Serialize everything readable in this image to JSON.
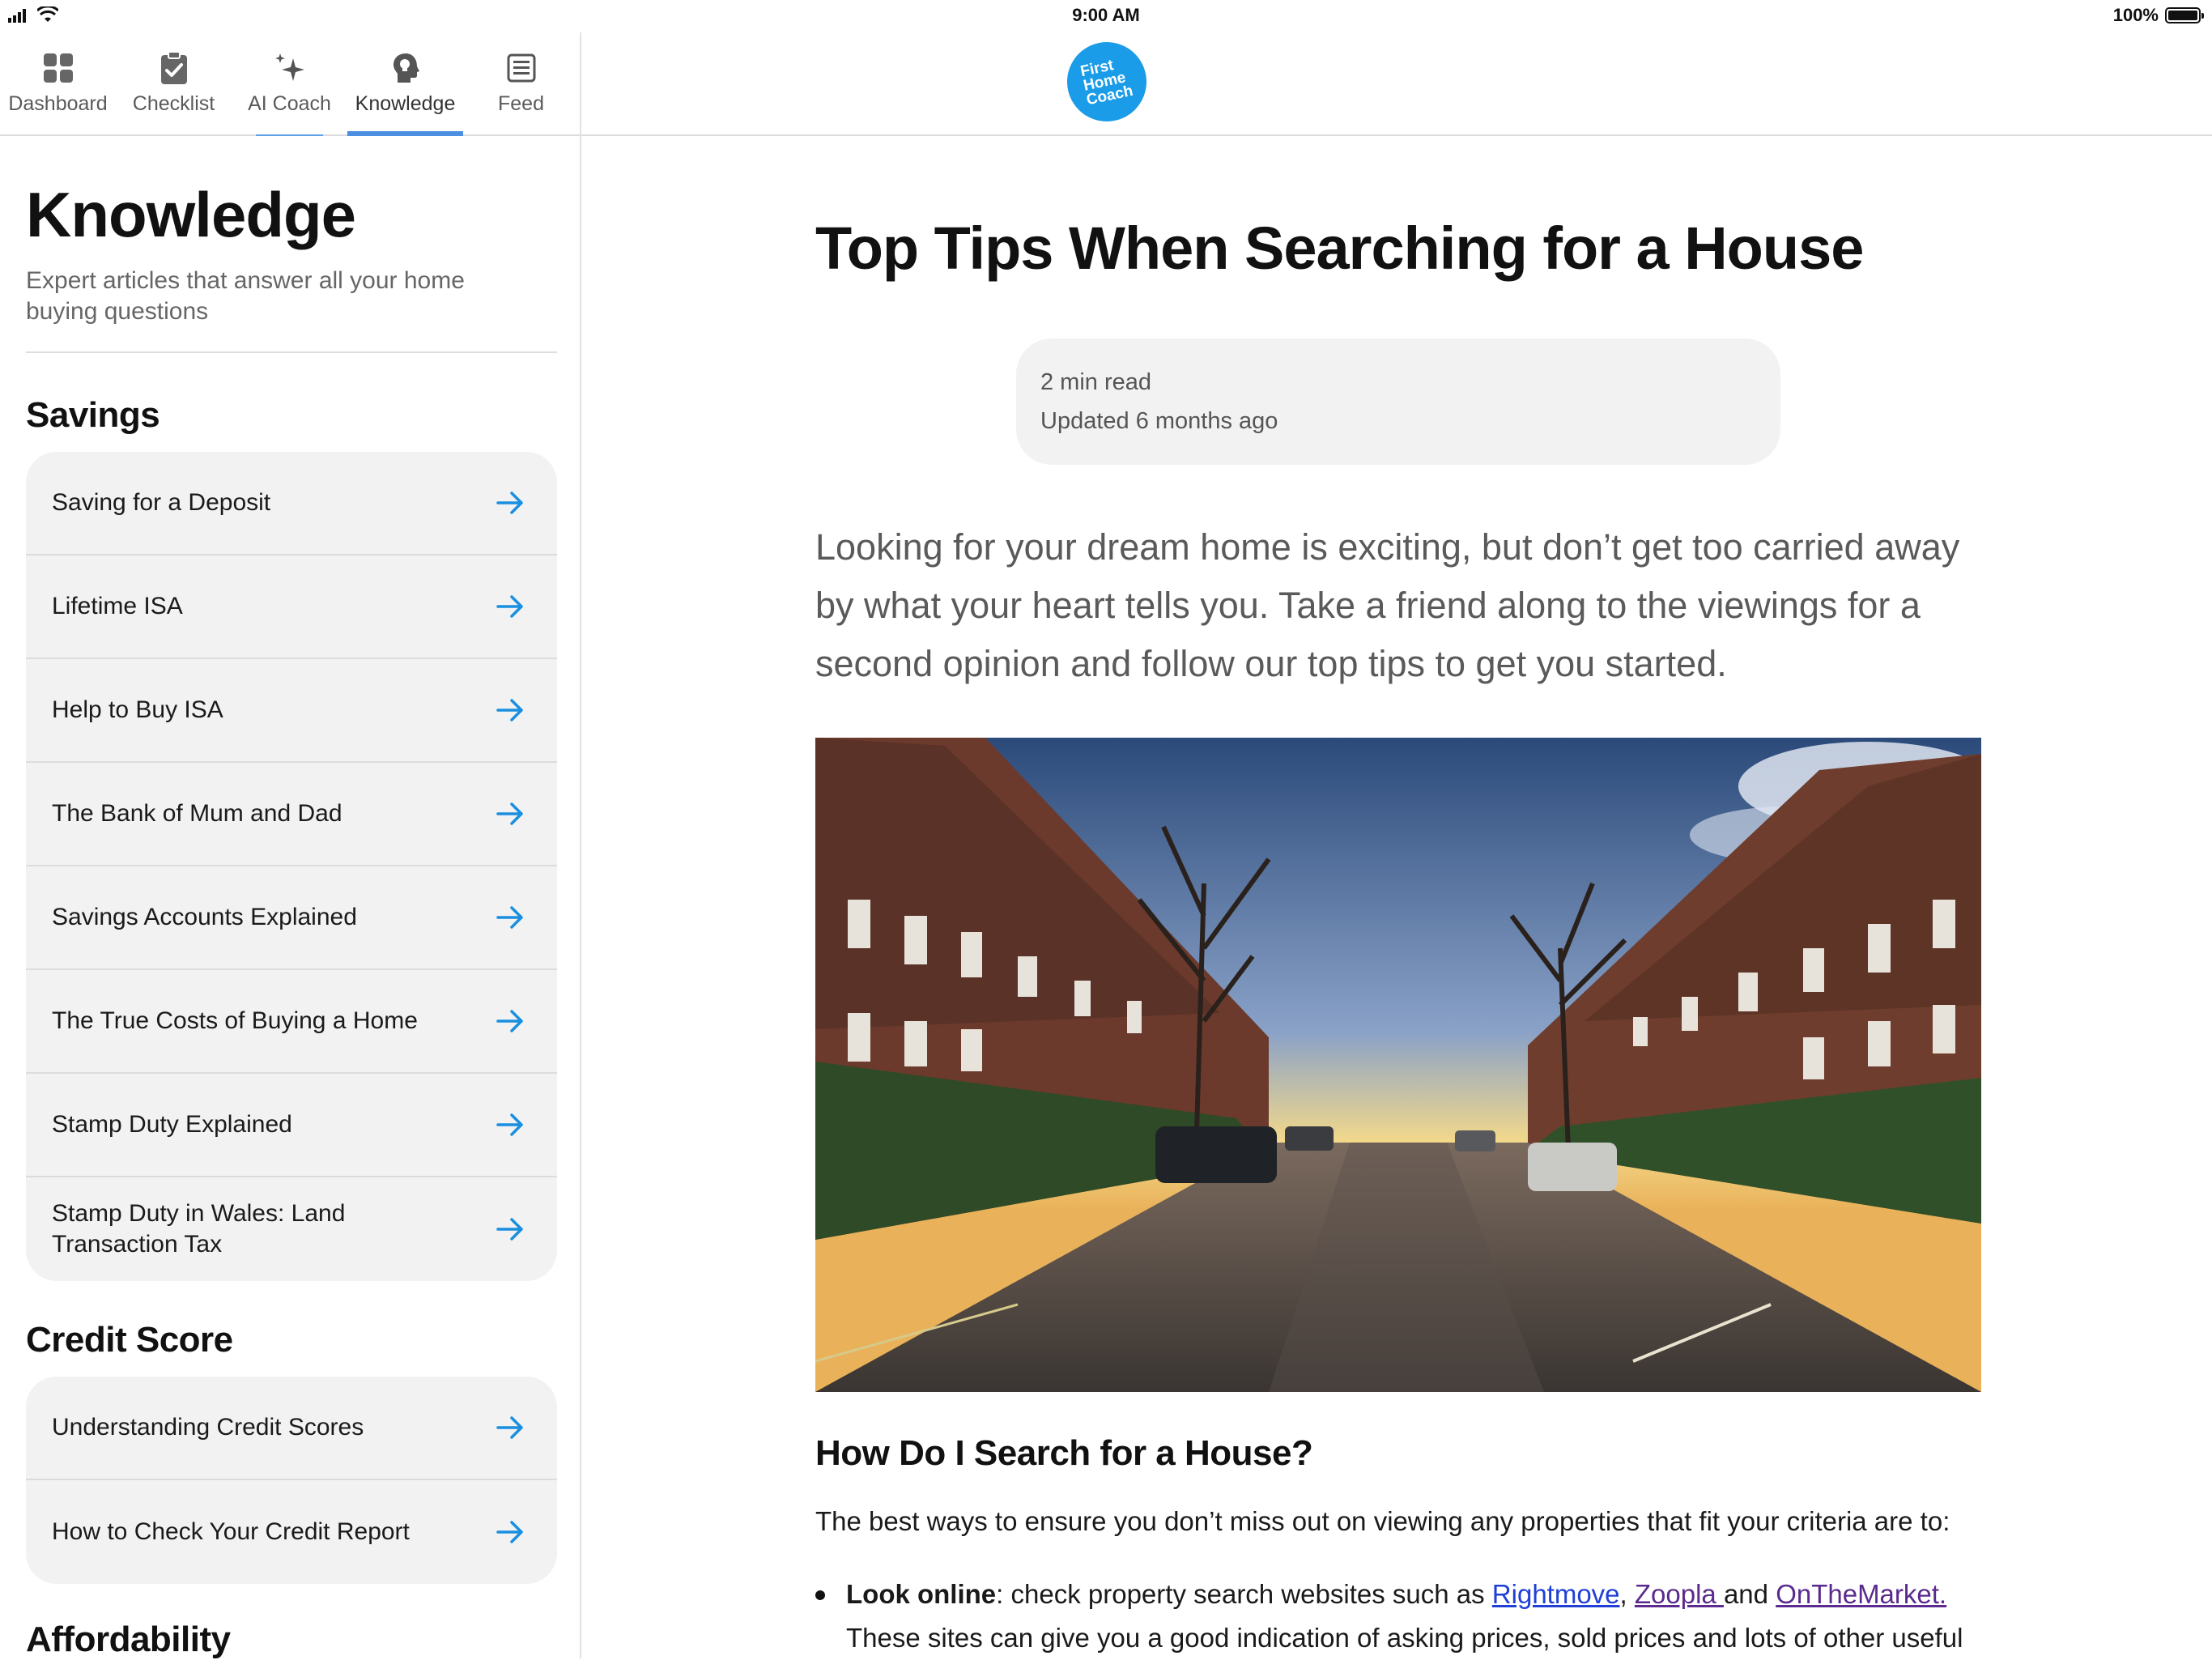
{
  "status_bar": {
    "time": "9:00 AM",
    "battery": "100%"
  },
  "tabs": [
    {
      "label": "Dashboard",
      "icon": "grid-icon"
    },
    {
      "label": "Checklist",
      "icon": "clipboard-check-icon"
    },
    {
      "label": "AI Coach",
      "icon": "sparkle-icon"
    },
    {
      "label": "Knowledge",
      "icon": "head-bulb-icon",
      "active": true
    },
    {
      "label": "Feed",
      "icon": "news-icon"
    }
  ],
  "knowledge": {
    "title": "Knowledge",
    "subtitle": "Expert articles that answer all your home buying questions"
  },
  "sections": [
    {
      "heading": "Savings",
      "items": [
        "Saving for a Deposit",
        "Lifetime ISA",
        "Help to Buy ISA",
        "The Bank of Mum and Dad",
        "Savings Accounts Explained",
        "The True Costs of Buying a Home",
        "Stamp Duty Explained",
        "Stamp Duty in Wales: Land Transaction Tax"
      ]
    },
    {
      "heading": "Credit Score",
      "items": [
        "Understanding Credit Scores",
        "How to Check Your Credit Report"
      ]
    },
    {
      "heading": "Affordability",
      "items": []
    }
  ],
  "logo": {
    "line1": "First",
    "line2": "Home",
    "line3": "Coach"
  },
  "article": {
    "title": "Top Tips When Searching for a House",
    "read_time": "2 min read",
    "updated": "Updated 6 months ago",
    "intro": "Looking for your dream home is exciting, but don’t get too carried away by what your heart tells you. Take a friend along to the viewings for a second opinion and follow our top tips to get you started.",
    "section_heading": "How Do I Search for a House?",
    "paragraph": "The best ways to ensure you don’t miss out on viewing any properties that fit your criteria are to:",
    "bullet": {
      "bold": "Look online",
      "text_before": ": check property search websites such as ",
      "link1": "Rightmove",
      "sep": ", ",
      "link2": "Zoopla ",
      "text_mid": "and ",
      "link3": "OnTheMarket.",
      "text_after": " These sites can give you a good indication of asking prices, sold prices and lots of other useful"
    }
  },
  "colors": {
    "accent": "#1a9ce8",
    "tab_indicator": "#4a8fe0",
    "card_bg": "#f2f2f2",
    "link": "#1f3fd6",
    "link_visited": "#5a2a8e"
  }
}
